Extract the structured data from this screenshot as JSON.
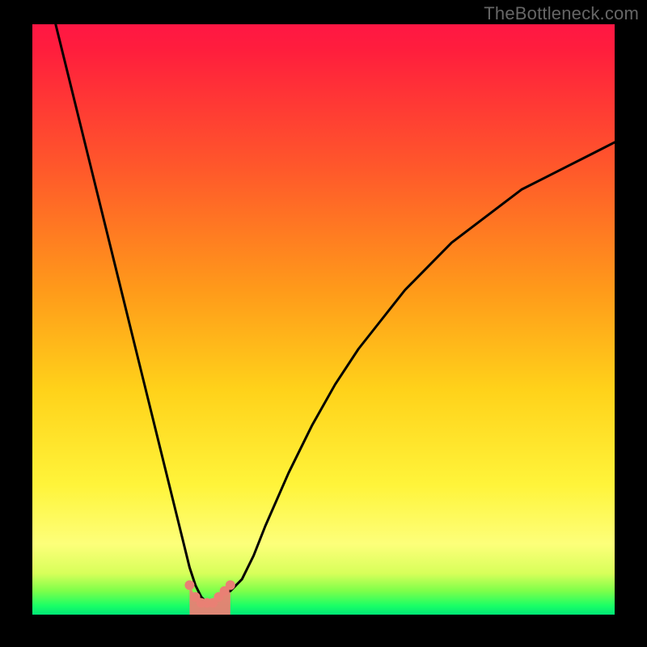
{
  "watermark": "TheBottleneck.com",
  "chart_data": {
    "type": "line",
    "title": "",
    "xlabel": "",
    "ylabel": "",
    "xlim": [
      0,
      100
    ],
    "ylim": [
      0,
      100
    ],
    "grid": false,
    "legend": false,
    "series": [
      {
        "name": "left-branch",
        "x": [
          4,
          6,
          8,
          10,
          12,
          14,
          16,
          18,
          20,
          22,
          24,
          26,
          27,
          28,
          29,
          30,
          31,
          32,
          33,
          34
        ],
        "values": [
          100,
          92,
          84,
          76,
          68,
          60,
          52,
          44,
          36,
          28,
          20,
          12,
          8,
          5,
          3,
          2,
          2,
          3,
          4,
          4
        ]
      },
      {
        "name": "right-branch",
        "x": [
          34,
          36,
          38,
          40,
          44,
          48,
          52,
          56,
          60,
          64,
          68,
          72,
          76,
          80,
          84,
          88,
          92,
          96,
          100
        ],
        "values": [
          4,
          6,
          10,
          15,
          24,
          32,
          39,
          45,
          50,
          55,
          59,
          63,
          66,
          69,
          72,
          74,
          76,
          78,
          80
        ]
      },
      {
        "name": "valley-beads",
        "x": [
          27,
          28,
          29,
          30,
          31,
          32,
          33,
          34
        ],
        "values": [
          5,
          3,
          2,
          2,
          2,
          3,
          4,
          5
        ]
      }
    ],
    "background_gradient_stops": [
      {
        "offset": 0.0,
        "color": "#ff1744"
      },
      {
        "offset": 0.04,
        "color": "#ff1d3d"
      },
      {
        "offset": 0.25,
        "color": "#ff5a2a"
      },
      {
        "offset": 0.45,
        "color": "#ff9a1a"
      },
      {
        "offset": 0.62,
        "color": "#ffd21a"
      },
      {
        "offset": 0.78,
        "color": "#fff43a"
      },
      {
        "offset": 0.88,
        "color": "#fdff7a"
      },
      {
        "offset": 0.93,
        "color": "#d8ff5a"
      },
      {
        "offset": 0.96,
        "color": "#7dff4a"
      },
      {
        "offset": 0.985,
        "color": "#1aff66"
      },
      {
        "offset": 1.0,
        "color": "#00e676"
      }
    ],
    "valley_fill_color": "#e98074",
    "curve_stroke": "#000000",
    "plot_bg_frame": "#000000"
  }
}
